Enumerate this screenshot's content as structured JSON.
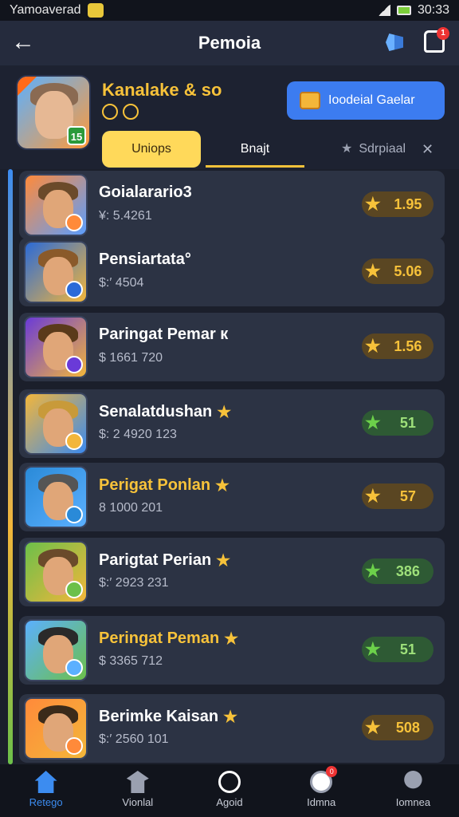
{
  "status_bar": {
    "carrier": "Yamoaverad",
    "time": "30:33"
  },
  "app_bar": {
    "title": "Pemoia",
    "notification_count": "1"
  },
  "header": {
    "app_name": "Kanalake & so",
    "level_badge": "15",
    "install_label": "Ioodeial Gaelar"
  },
  "tabs": {
    "tab1": "Uniops",
    "tab2": "Bnajt",
    "tab3": "Sdrpiaal"
  },
  "rows": [
    {
      "name": "Goialarario3",
      "meta": "¥: 5.4261",
      "rating": "1.95",
      "color": "orange",
      "star_name": false
    },
    {
      "name": "Pensiartata°",
      "meta": "$:′ 4504",
      "rating": "5.06",
      "color": "orange",
      "star_name": false
    },
    {
      "name": "Paringat Pemar к",
      "meta": "$ 1661  720",
      "rating": "1.56",
      "color": "orange",
      "star_name": false
    },
    {
      "name": "Senalatdushan",
      "meta": "$: 2 4920  123",
      "rating": "51",
      "color": "green",
      "star_name": true
    },
    {
      "name": "Perigat Ponlan",
      "meta": "8 1000  201",
      "rating": "57",
      "color": "orange",
      "star_name": true
    },
    {
      "name": "Parigtat Perian",
      "meta": "$:′ 2923  231",
      "rating": "386",
      "color": "green",
      "star_name": true
    },
    {
      "name": "Peringat Peman",
      "meta": "$ 3365  712",
      "rating": "51",
      "color": "green",
      "star_name": true
    },
    {
      "name": "Berimke  Kaisan",
      "meta": "$:′ 2560  101",
      "rating": "508",
      "color": "orange",
      "star_name": true
    }
  ],
  "bottom_nav": [
    {
      "label": "Retego",
      "icon": "home-icon"
    },
    {
      "label": "Vionlal",
      "icon": "hat-icon"
    },
    {
      "label": "Agoid",
      "icon": "clock-icon"
    },
    {
      "label": "Idmna",
      "icon": "chat-icon",
      "badge": "0"
    },
    {
      "label": "Iomnea",
      "icon": "user-icon"
    }
  ],
  "colors": {
    "accent": "#3c7cf0",
    "gold": "#f7c23a",
    "green": "#6cd04a"
  }
}
